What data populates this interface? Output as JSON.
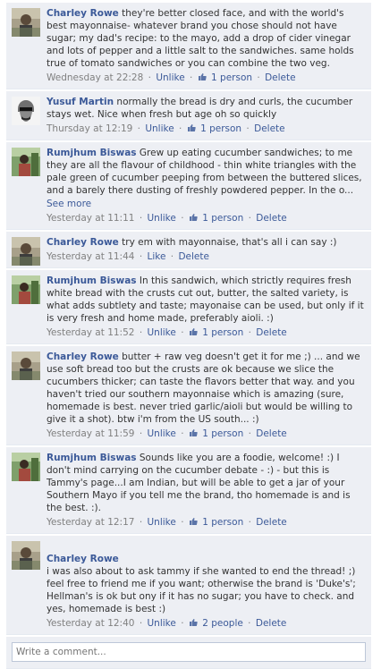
{
  "comments": [
    {
      "author": "Charley Rowe",
      "text": "they're better closed face, and with the world's best mayonnaise- whatever brand you chose should not have sugar; my dad's recipe: to the mayo, add a drop of cider vinegar and lots of pepper and a little salt to the sandwiches. same holds true of tomato sandwiches or you can combine the two veg.",
      "timestamp": "Wednesday at 22:28",
      "action_label": "Unlike",
      "likes_label": "1 person",
      "delete_label": "Delete"
    },
    {
      "author": "Yusuf Martin",
      "text": "normally the bread is dry and curls, the cucumber stays wet. Nice when fresh but age oh so quickly",
      "timestamp": "Thursday at 12:19",
      "action_label": "Unlike",
      "likes_label": "1 person",
      "delete_label": "Delete"
    },
    {
      "author": "Rumjhum Biswas",
      "text": "Grew up eating cucumber sandwiches; to me they are all the flavour of childhood - thin white triangles with the pale green of cucumber peeping from between the buttered slices, and a barely there dusting of freshly powdered pepper. In the o...",
      "see_more": "See more",
      "timestamp": "Yesterday at 11:11",
      "action_label": "Unlike",
      "likes_label": "1 person",
      "delete_label": "Delete"
    },
    {
      "author": "Charley Rowe",
      "text": "try em with mayonnaise, that's all i can say :)",
      "timestamp": "Yesterday at 11:44",
      "action_label": "Like",
      "delete_label": "Delete"
    },
    {
      "author": "Rumjhum Biswas",
      "text": "In this sandwich, which strictly requires fresh white bread with the crusts cut out, butter, the salted variety, is what adds subtlety and taste; mayonaise can be used, but only if it is very fresh and home made, preferably aioli. :)",
      "timestamp": "Yesterday at 11:52",
      "action_label": "Unlike",
      "likes_label": "1 person",
      "delete_label": "Delete"
    },
    {
      "author": "Charley Rowe",
      "text": "butter + raw veg doesn't get it for me ;) ... and we use soft bread too but the crusts are ok because we slice the cucumbers thicker; can taste the flavors better that way. and you haven't tried our southern mayonnaise which is amazing (sure, homemade is best. never tried garlic/aioli but would be willing to give it a shot). btw i'm from the US south... :)",
      "timestamp": "Yesterday at 11:59",
      "action_label": "Unlike",
      "likes_label": "1 person",
      "delete_label": "Delete"
    },
    {
      "author": "Rumjhum Biswas",
      "text": "Sounds like you are a foodie, welcome! :) I don't mind carrying on the cucumber debate - :) - but this is Tammy's page...I am Indian, but will be able to get a jar of your Southern Mayo if you tell me the brand, tho homemade is and is the best. :).",
      "timestamp": "Yesterday at 12:17",
      "action_label": "Unlike",
      "likes_label": "1 person",
      "delete_label": "Delete"
    },
    {
      "author": "Charley Rowe",
      "text": "i was also about to ask tammy if she wanted to end the thread! ;)\nfeel free to friend me if you want; otherwise the brand is 'Duke's'; Hellman's is ok but ony if it has no sugar; you have to check. and yes, homemade is best :)",
      "timestamp": "Yesterday at 12:40",
      "action_label": "Unlike",
      "likes_label": "2 people",
      "delete_label": "Delete"
    }
  ],
  "separator": "·",
  "write_comment": {
    "placeholder": "Write a comment..."
  },
  "colors": {
    "link": "#3b5998",
    "comment_bg": "#edeff4",
    "meta": "#808080"
  }
}
